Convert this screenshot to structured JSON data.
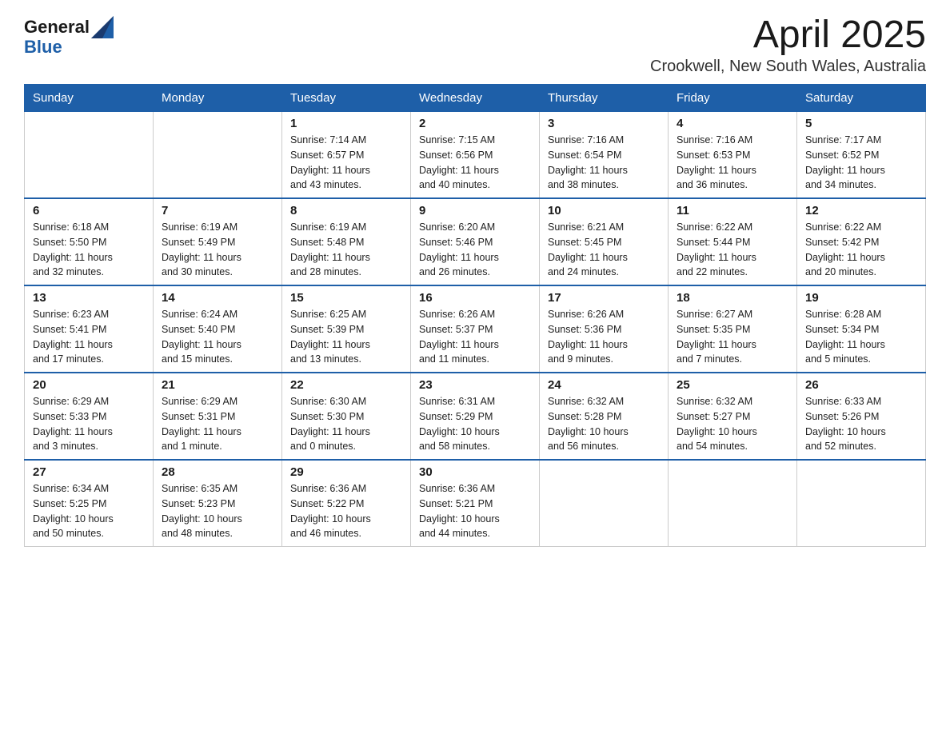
{
  "header": {
    "logo_general": "General",
    "logo_blue": "Blue",
    "month_year": "April 2025",
    "location": "Crookwell, New South Wales, Australia"
  },
  "weekdays": [
    "Sunday",
    "Monday",
    "Tuesday",
    "Wednesday",
    "Thursday",
    "Friday",
    "Saturday"
  ],
  "weeks": [
    [
      {
        "day": "",
        "info": ""
      },
      {
        "day": "",
        "info": ""
      },
      {
        "day": "1",
        "info": "Sunrise: 7:14 AM\nSunset: 6:57 PM\nDaylight: 11 hours\nand 43 minutes."
      },
      {
        "day": "2",
        "info": "Sunrise: 7:15 AM\nSunset: 6:56 PM\nDaylight: 11 hours\nand 40 minutes."
      },
      {
        "day": "3",
        "info": "Sunrise: 7:16 AM\nSunset: 6:54 PM\nDaylight: 11 hours\nand 38 minutes."
      },
      {
        "day": "4",
        "info": "Sunrise: 7:16 AM\nSunset: 6:53 PM\nDaylight: 11 hours\nand 36 minutes."
      },
      {
        "day": "5",
        "info": "Sunrise: 7:17 AM\nSunset: 6:52 PM\nDaylight: 11 hours\nand 34 minutes."
      }
    ],
    [
      {
        "day": "6",
        "info": "Sunrise: 6:18 AM\nSunset: 5:50 PM\nDaylight: 11 hours\nand 32 minutes."
      },
      {
        "day": "7",
        "info": "Sunrise: 6:19 AM\nSunset: 5:49 PM\nDaylight: 11 hours\nand 30 minutes."
      },
      {
        "day": "8",
        "info": "Sunrise: 6:19 AM\nSunset: 5:48 PM\nDaylight: 11 hours\nand 28 minutes."
      },
      {
        "day": "9",
        "info": "Sunrise: 6:20 AM\nSunset: 5:46 PM\nDaylight: 11 hours\nand 26 minutes."
      },
      {
        "day": "10",
        "info": "Sunrise: 6:21 AM\nSunset: 5:45 PM\nDaylight: 11 hours\nand 24 minutes."
      },
      {
        "day": "11",
        "info": "Sunrise: 6:22 AM\nSunset: 5:44 PM\nDaylight: 11 hours\nand 22 minutes."
      },
      {
        "day": "12",
        "info": "Sunrise: 6:22 AM\nSunset: 5:42 PM\nDaylight: 11 hours\nand 20 minutes."
      }
    ],
    [
      {
        "day": "13",
        "info": "Sunrise: 6:23 AM\nSunset: 5:41 PM\nDaylight: 11 hours\nand 17 minutes."
      },
      {
        "day": "14",
        "info": "Sunrise: 6:24 AM\nSunset: 5:40 PM\nDaylight: 11 hours\nand 15 minutes."
      },
      {
        "day": "15",
        "info": "Sunrise: 6:25 AM\nSunset: 5:39 PM\nDaylight: 11 hours\nand 13 minutes."
      },
      {
        "day": "16",
        "info": "Sunrise: 6:26 AM\nSunset: 5:37 PM\nDaylight: 11 hours\nand 11 minutes."
      },
      {
        "day": "17",
        "info": "Sunrise: 6:26 AM\nSunset: 5:36 PM\nDaylight: 11 hours\nand 9 minutes."
      },
      {
        "day": "18",
        "info": "Sunrise: 6:27 AM\nSunset: 5:35 PM\nDaylight: 11 hours\nand 7 minutes."
      },
      {
        "day": "19",
        "info": "Sunrise: 6:28 AM\nSunset: 5:34 PM\nDaylight: 11 hours\nand 5 minutes."
      }
    ],
    [
      {
        "day": "20",
        "info": "Sunrise: 6:29 AM\nSunset: 5:33 PM\nDaylight: 11 hours\nand 3 minutes."
      },
      {
        "day": "21",
        "info": "Sunrise: 6:29 AM\nSunset: 5:31 PM\nDaylight: 11 hours\nand 1 minute."
      },
      {
        "day": "22",
        "info": "Sunrise: 6:30 AM\nSunset: 5:30 PM\nDaylight: 11 hours\nand 0 minutes."
      },
      {
        "day": "23",
        "info": "Sunrise: 6:31 AM\nSunset: 5:29 PM\nDaylight: 10 hours\nand 58 minutes."
      },
      {
        "day": "24",
        "info": "Sunrise: 6:32 AM\nSunset: 5:28 PM\nDaylight: 10 hours\nand 56 minutes."
      },
      {
        "day": "25",
        "info": "Sunrise: 6:32 AM\nSunset: 5:27 PM\nDaylight: 10 hours\nand 54 minutes."
      },
      {
        "day": "26",
        "info": "Sunrise: 6:33 AM\nSunset: 5:26 PM\nDaylight: 10 hours\nand 52 minutes."
      }
    ],
    [
      {
        "day": "27",
        "info": "Sunrise: 6:34 AM\nSunset: 5:25 PM\nDaylight: 10 hours\nand 50 minutes."
      },
      {
        "day": "28",
        "info": "Sunrise: 6:35 AM\nSunset: 5:23 PM\nDaylight: 10 hours\nand 48 minutes."
      },
      {
        "day": "29",
        "info": "Sunrise: 6:36 AM\nSunset: 5:22 PM\nDaylight: 10 hours\nand 46 minutes."
      },
      {
        "day": "30",
        "info": "Sunrise: 6:36 AM\nSunset: 5:21 PM\nDaylight: 10 hours\nand 44 minutes."
      },
      {
        "day": "",
        "info": ""
      },
      {
        "day": "",
        "info": ""
      },
      {
        "day": "",
        "info": ""
      }
    ]
  ]
}
